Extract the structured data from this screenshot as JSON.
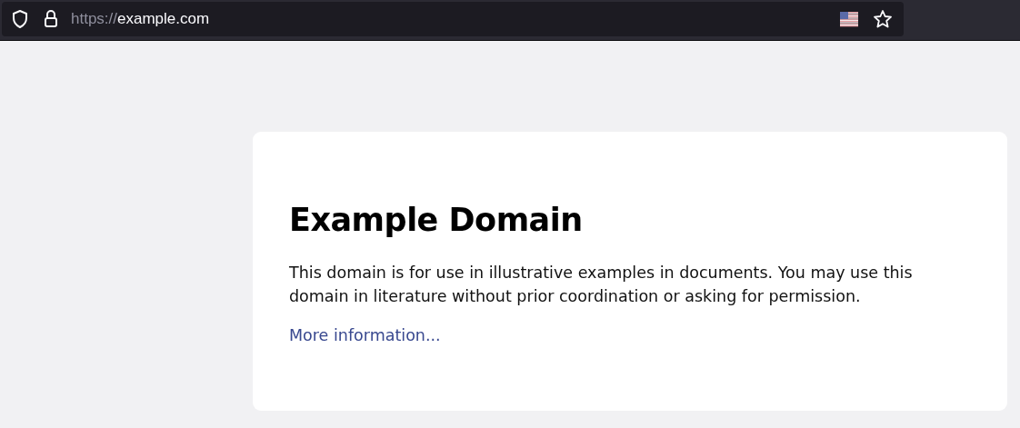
{
  "address_bar": {
    "scheme": "https://",
    "host": "example.com"
  },
  "page": {
    "title": "Example Domain",
    "paragraph": "This domain is for use in illustrative examples in documents. You may use this domain in literature without prior coordination or asking for permission.",
    "link": "More information..."
  }
}
